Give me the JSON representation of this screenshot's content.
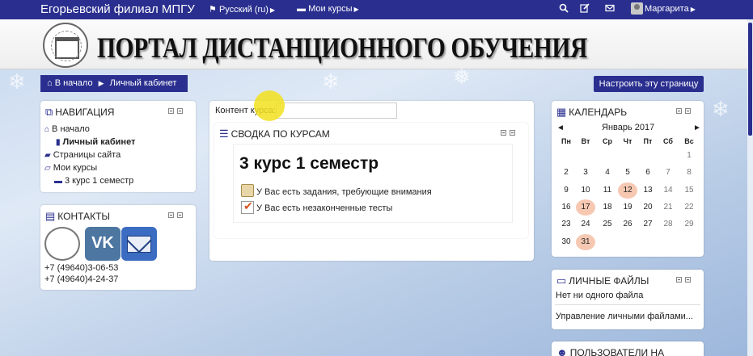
{
  "navbar": {
    "brand": "Егорьевский филиал МПГУ",
    "language": "Русский (ru)",
    "my_courses": "Мои курсы",
    "user_name": "Маргарита",
    "icons": [
      "search-icon",
      "edit-icon",
      "envelope-icon"
    ]
  },
  "header": {
    "portal_title": "ПОРТАЛ ДИСТАНЦИОННОГО ОБУЧЕНИЯ"
  },
  "breadcrumb": {
    "home": "В начало",
    "current": "Личный кабинет"
  },
  "customize_button": "Настроить эту страницу",
  "navigation": {
    "title": "НАВИГАЦИЯ",
    "items": [
      {
        "label": "В начало",
        "icon": "home-icon"
      },
      {
        "label": "Личный кабинет",
        "icon": "dashboard-icon"
      },
      {
        "label": "Страницы сайта",
        "icon": "folder-icon"
      },
      {
        "label": "Мои курсы",
        "icon": "folder-open-icon"
      },
      {
        "label": "3 курс 1 семестр",
        "icon": "course-icon"
      }
    ]
  },
  "contacts": {
    "title": "КОНТАКТЫ",
    "vk_label": "VK",
    "phones": [
      "+7 (49640)3-06-53",
      "+7 (49640)4-24-37"
    ]
  },
  "main": {
    "content_label": "Контент курса:",
    "overview_title": "СВОДКА ПО КУРСАМ",
    "course_name": "3 курс 1 семестр",
    "alerts": [
      "У Вас есть задания, требующие внимания",
      "У Вас есть незаконченные тесты"
    ]
  },
  "calendar": {
    "title": "КАЛЕНДАРЬ",
    "month": "Январь 2017",
    "prev": "◄",
    "next": "►",
    "weekdays": [
      "Пн",
      "Вт",
      "Ср",
      "Чт",
      "Пт",
      "Сб",
      "Вс"
    ],
    "weeks": [
      [
        "",
        "",
        "",
        "",
        "",
        "",
        "1"
      ],
      [
        "2",
        "3",
        "4",
        "5",
        "6",
        "7",
        "8"
      ],
      [
        "9",
        "10",
        "11",
        "12",
        "13",
        "14",
        "15"
      ],
      [
        "16",
        "17",
        "18",
        "19",
        "20",
        "21",
        "22"
      ],
      [
        "23",
        "24",
        "25",
        "26",
        "27",
        "28",
        "29"
      ],
      [
        "30",
        "31",
        "",
        "",
        "",
        "",
        ""
      ]
    ],
    "event_days": [
      "12",
      "17",
      "31"
    ],
    "event_color": "#f6c8b2"
  },
  "files": {
    "title": "ЛИЧНЫЕ ФАЙЛЫ",
    "empty": "Нет ни одного файла",
    "manage": "Управление личными файлами..."
  },
  "users": {
    "title": "ПОЛЬЗОВАТЕЛИ НА"
  },
  "colors": {
    "accent": "#2a2f8f"
  }
}
